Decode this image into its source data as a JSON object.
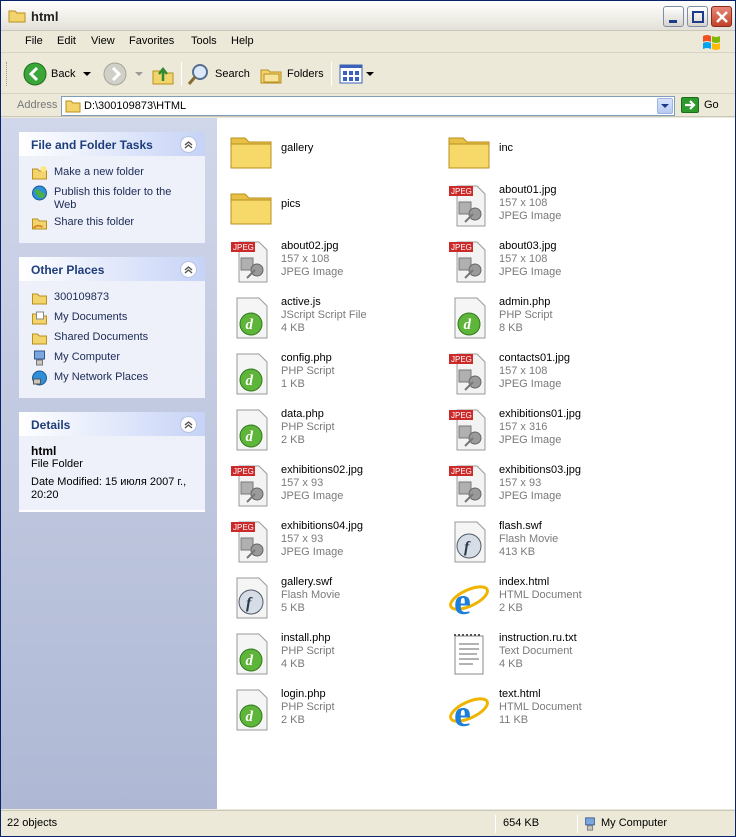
{
  "window": {
    "title": "html"
  },
  "menu": [
    "File",
    "Edit",
    "View",
    "Favorites",
    "Tools",
    "Help"
  ],
  "toolbar": {
    "back_label": "Back",
    "search_label": "Search",
    "folders_label": "Folders"
  },
  "address": {
    "label": "Address",
    "value": "D:\\300109873\\HTML",
    "go_label": "Go"
  },
  "tasks_panel": {
    "title": "File and Folder Tasks",
    "items": [
      "Make a new folder",
      "Publish this folder to the Web",
      "Share this folder"
    ]
  },
  "places_panel": {
    "title": "Other Places",
    "items": [
      "300109873",
      "My Documents",
      "Shared Documents",
      "My Computer",
      "My Network Places"
    ]
  },
  "details_panel": {
    "title": "Details",
    "name": "html",
    "type": "File Folder",
    "modified": "Date Modified: 15 июля 2007 г., 20:20"
  },
  "files": [
    {
      "name": "gallery",
      "line1": "",
      "line2": "",
      "icon": "folder"
    },
    {
      "name": "inc",
      "line1": "",
      "line2": "",
      "icon": "folder"
    },
    {
      "name": "pics",
      "line1": "",
      "line2": "",
      "icon": "folder"
    },
    {
      "name": "about01.jpg",
      "line1": "157 x 108",
      "line2": "JPEG Image",
      "icon": "jpeg"
    },
    {
      "name": "about02.jpg",
      "line1": "157 x 108",
      "line2": "JPEG Image",
      "icon": "jpeg"
    },
    {
      "name": "about03.jpg",
      "line1": "157 x 108",
      "line2": "JPEG Image",
      "icon": "jpeg"
    },
    {
      "name": "active.js",
      "line1": "JScript Script File",
      "line2": "4 KB",
      "icon": "dw"
    },
    {
      "name": "admin.php",
      "line1": "PHP Script",
      "line2": "8 KB",
      "icon": "dw"
    },
    {
      "name": "config.php",
      "line1": "PHP Script",
      "line2": "1 KB",
      "icon": "dw"
    },
    {
      "name": "contacts01.jpg",
      "line1": "157 x 108",
      "line2": "JPEG Image",
      "icon": "jpeg"
    },
    {
      "name": "data.php",
      "line1": "PHP Script",
      "line2": "2 KB",
      "icon": "dw"
    },
    {
      "name": "exhibitions01.jpg",
      "line1": "157 x 316",
      "line2": "JPEG Image",
      "icon": "jpeg"
    },
    {
      "name": "exhibitions02.jpg",
      "line1": "157 x 93",
      "line2": "JPEG Image",
      "icon": "jpeg"
    },
    {
      "name": "exhibitions03.jpg",
      "line1": "157 x 93",
      "line2": "JPEG Image",
      "icon": "jpeg"
    },
    {
      "name": "exhibitions04.jpg",
      "line1": "157 x 93",
      "line2": "JPEG Image",
      "icon": "jpeg"
    },
    {
      "name": "flash.swf",
      "line1": "Flash Movie",
      "line2": "413 KB",
      "icon": "flash"
    },
    {
      "name": "gallery.swf",
      "line1": "Flash Movie",
      "line2": "5 KB",
      "icon": "flash"
    },
    {
      "name": "index.html",
      "line1": "HTML Document",
      "line2": "2 KB",
      "icon": "ie"
    },
    {
      "name": "install.php",
      "line1": "PHP Script",
      "line2": "4 KB",
      "icon": "dw"
    },
    {
      "name": "instruction.ru.txt",
      "line1": "Text Document",
      "line2": "4 KB",
      "icon": "txt"
    },
    {
      "name": "login.php",
      "line1": "PHP Script",
      "line2": "2 KB",
      "icon": "dw"
    },
    {
      "name": "text.html",
      "line1": "HTML Document",
      "line2": "11 KB",
      "icon": "ie"
    }
  ],
  "status": {
    "objects": "22 objects",
    "size": "654 KB",
    "location": "My Computer"
  }
}
